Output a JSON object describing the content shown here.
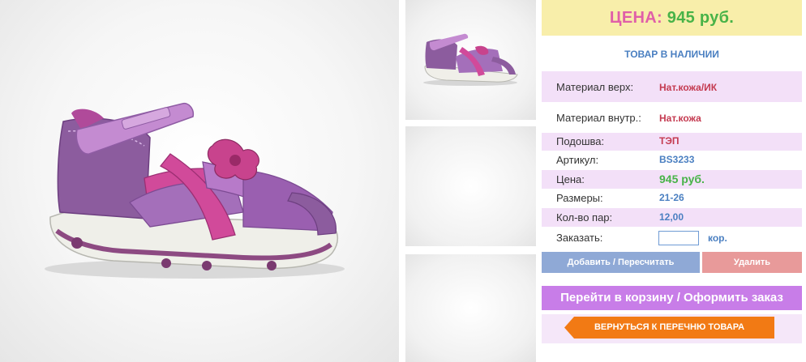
{
  "product": {
    "main_image": "sandal-main-photo",
    "thumbnails": [
      "sandal-thumbnail",
      "empty-thumbnail",
      "empty-thumbnail"
    ]
  },
  "price_banner": {
    "label": "ЦЕНА:",
    "value": "945 руб."
  },
  "stock_status": "ТОВАР В НАЛИЧИИ",
  "specs": {
    "upper_material": {
      "label": "Материал верх:",
      "value": "Нат.кожа/ИК"
    },
    "inner_material": {
      "label": "Материал внутр.:",
      "value": "Нат.кожа"
    },
    "sole": {
      "label": "Подошва:",
      "value": "ТЭП"
    },
    "article": {
      "label": "Артикул:",
      "value": "BS3233"
    },
    "price": {
      "label": "Цена:",
      "value": "945 руб."
    },
    "sizes": {
      "label": "Размеры:",
      "value": "21-26"
    },
    "pairs": {
      "label": "Кол-во пар:",
      "value": "12,00"
    }
  },
  "order": {
    "label": "Заказать:",
    "quantity_value": "",
    "unit": "кор."
  },
  "buttons": {
    "add": "Добавить / Пересчитать",
    "delete": "Удалить",
    "cart": "Перейти в корзину / Оформить заказ",
    "back": "ВЕРНУТЬСЯ К ПЕРЕЧНЮ ТОВАРА"
  },
  "colors": {
    "price_label": "#e05fa8",
    "price_value": "#48b348",
    "banner_bg": "#f8eeaa",
    "accent_blue": "#4a7fc1",
    "shaded_row": "#f3e0f8",
    "add_button": "#8fa9d6",
    "delete_button": "#e89a9a",
    "cart_button": "#c87de8",
    "back_button": "#f27a14"
  }
}
